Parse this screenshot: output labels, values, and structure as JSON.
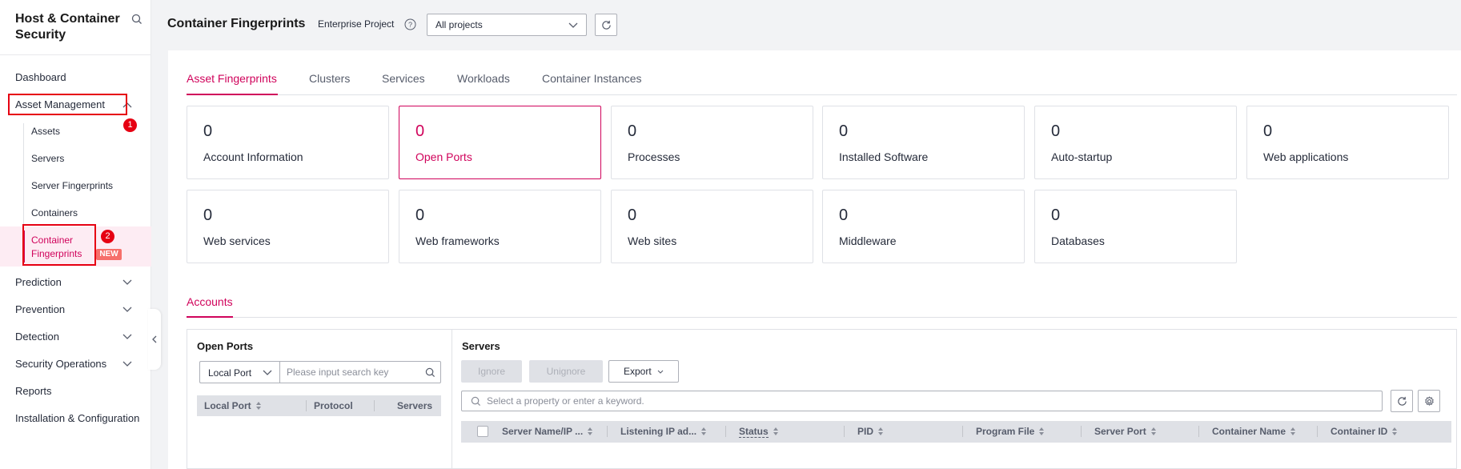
{
  "sidebar": {
    "title": "Host & Container Security",
    "items": [
      {
        "label": "Dashboard"
      },
      {
        "label": "Asset Management"
      },
      {
        "label": "Prediction"
      },
      {
        "label": "Prevention"
      },
      {
        "label": "Detection"
      },
      {
        "label": "Security Operations"
      },
      {
        "label": "Reports"
      },
      {
        "label": "Installation & Configuration"
      }
    ],
    "sub_items": [
      {
        "label": "Assets"
      },
      {
        "label": "Servers"
      },
      {
        "label": "Server Fingerprints"
      },
      {
        "label": "Containers"
      }
    ],
    "active_line1": "Container",
    "active_line2": "Fingerprints",
    "new_badge": "NEW",
    "marker_1": "1",
    "marker_2": "2"
  },
  "header": {
    "title": "Container Fingerprints",
    "enterprise_label": "Enterprise Project",
    "project_value": "All projects"
  },
  "tabs": [
    {
      "label": "Asset Fingerprints",
      "active": true
    },
    {
      "label": "Clusters"
    },
    {
      "label": "Services"
    },
    {
      "label": "Workloads"
    },
    {
      "label": "Container Instances"
    }
  ],
  "cards": [
    {
      "value": "0",
      "label": "Account Information"
    },
    {
      "value": "0",
      "label": "Open Ports",
      "active": true
    },
    {
      "value": "0",
      "label": "Processes"
    },
    {
      "value": "0",
      "label": "Installed Software"
    },
    {
      "value": "0",
      "label": "Auto-startup"
    },
    {
      "value": "0",
      "label": "Web applications"
    },
    {
      "value": "0",
      "label": "Web services"
    },
    {
      "value": "0",
      "label": "Web frameworks"
    },
    {
      "value": "0",
      "label": "Web sites"
    },
    {
      "value": "0",
      "label": "Middleware"
    },
    {
      "value": "0",
      "label": "Databases"
    }
  ],
  "sub_tab": "Accounts",
  "left_panel": {
    "title": "Open Ports",
    "filter_value": "Local Port",
    "search_placeholder": "Please input search key",
    "columns": [
      "Local Port",
      "Protocol",
      "Servers"
    ]
  },
  "right_panel": {
    "title": "Servers",
    "buttons": {
      "ignore": "Ignore",
      "unignore": "Unignore",
      "export": "Export"
    },
    "search_placeholder": "Select a property or enter a keyword.",
    "columns": [
      "Server Name/IP ...",
      "Listening IP ad...",
      "Status",
      "PID",
      "Program File",
      "Server Port",
      "Container Name",
      "Container ID"
    ]
  },
  "colors": {
    "accent": "#d0035b",
    "annotation": "#e60012",
    "badge": "#f66f6a"
  }
}
